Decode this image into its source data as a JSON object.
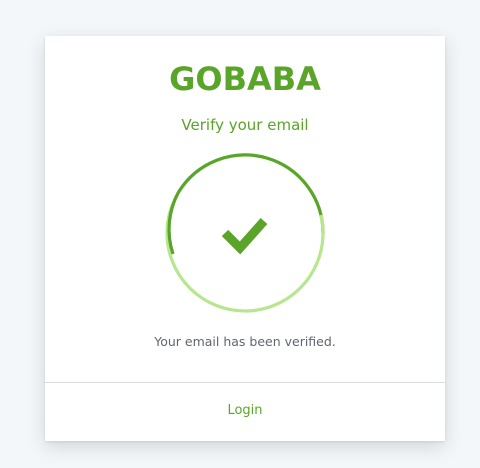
{
  "brand": {
    "name": "GOBABA",
    "color": "#5aa42a",
    "light_color": "#b6e68d"
  },
  "card": {
    "title": "Verify your email",
    "status_icon": "check-icon",
    "message": "Your email has been verified.",
    "login_label": "Login"
  }
}
